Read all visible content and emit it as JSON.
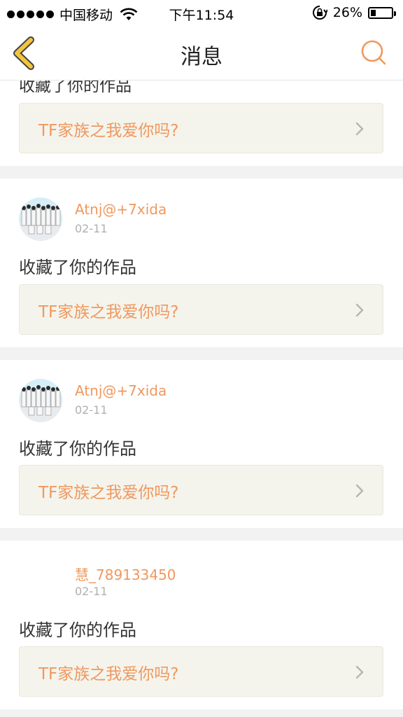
{
  "status_bar": {
    "carrier": "中国移动",
    "time": "下午11:54",
    "battery": "26%",
    "battery_level": 0.26
  },
  "nav": {
    "title": "消息",
    "back_icon": "chevron-left-icon",
    "search_icon": "search-icon"
  },
  "colors": {
    "accent": "#f0985e",
    "back_icon": "#f2c53d",
    "card_bg": "#f4f4ec",
    "separator": "#f2f2f2"
  },
  "partial_item": {
    "action": "收藏了你的作品",
    "work_title": "TF家族之我爱你吗?"
  },
  "messages": [
    {
      "username": "Atnj@+7xida",
      "date": "02-11",
      "action": "收藏了你的作品",
      "work_title": "TF家族之我爱你吗?",
      "has_avatar": true
    },
    {
      "username": "Atnj@+7xida",
      "date": "02-11",
      "action": "收藏了你的作品",
      "work_title": "TF家族之我爱你吗?",
      "has_avatar": true
    },
    {
      "username": "慧_789133450",
      "date": "02-11",
      "action": "收藏了你的作品",
      "work_title": "TF家族之我爱你吗?",
      "has_avatar": false
    }
  ]
}
